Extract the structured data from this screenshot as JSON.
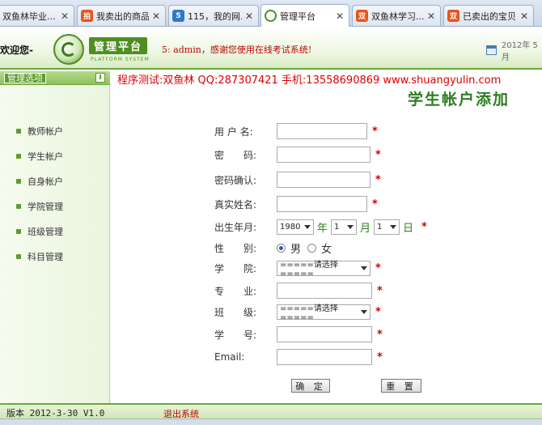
{
  "browser": {
    "tabs": [
      {
        "title": "双鱼林毕业...",
        "favicon": "",
        "color": "#f2f2f2"
      },
      {
        "title": "我卖出的商品",
        "favicon": "拍",
        "color": "#e8541c"
      },
      {
        "title": "115，我的网...",
        "favicon": "5",
        "color": "#2f79c8"
      },
      {
        "title": "管理平台",
        "favicon": "",
        "color": "#4e8f1f"
      },
      {
        "title": "双鱼林学习...",
        "favicon": "双",
        "color": "#e8541c"
      },
      {
        "title": "已卖出的宝贝",
        "favicon": "双",
        "color": "#e8541c"
      }
    ],
    "close_glyph": "✕"
  },
  "header": {
    "welcome": "欢迎您-",
    "logo_title": "管理平台",
    "logo_subtitle": "PLATFORM SYSTEM",
    "marquee": "5: admin，感谢您使用在线考试系统!",
    "date": "2012年 5月"
  },
  "sidebar": {
    "heading": "管理选项",
    "toggle_glyph": "⬇",
    "items": [
      {
        "label": "教师帐户"
      },
      {
        "label": "学生帐户"
      },
      {
        "label": "自身帐户"
      },
      {
        "label": "学院管理"
      },
      {
        "label": "班级管理"
      },
      {
        "label": "科目管理"
      }
    ]
  },
  "main": {
    "contact": "程序测试:双鱼林 QQ:287307421 手机:13558690869 www.shuangyulin.com",
    "title": "学生帐户添加",
    "form": {
      "username_label": "用 户 名:",
      "password_label": "密　　码:",
      "confirm_label": "密码确认:",
      "realname_label": "真实姓名:",
      "birth_label": "出生年月:",
      "gender_label": "性　　别:",
      "college_label": "学　　院:",
      "major_label": "专　　业:",
      "class_label": "班　　级:",
      "studentno_label": "学　　号:",
      "email_label": "Email:",
      "required_mark": "*",
      "birth_year": "1980",
      "birth_month": "1",
      "birth_day": "1",
      "year_unit": "年",
      "month_unit": "月",
      "day_unit": "日",
      "gender_male": "男",
      "gender_female": "女",
      "college_select": "=====请选择=====",
      "class_select": "=====请选择=====",
      "submit": "确 定",
      "reset": "重 置"
    }
  },
  "footer": {
    "version": "版本 2012-3-30 V1.0",
    "logout": "退出系统"
  }
}
